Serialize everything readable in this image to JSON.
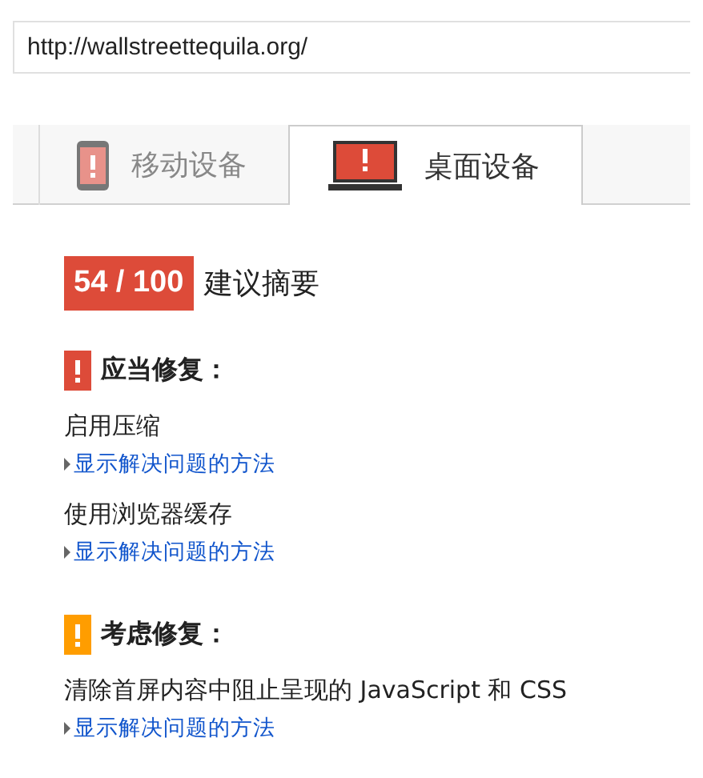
{
  "url": {
    "value": "http://wallstreettequila.org/"
  },
  "tabs": [
    {
      "label": "移动设备",
      "kind": "mobile",
      "selected": false
    },
    {
      "label": "桌面设备",
      "kind": "desktop",
      "selected": true
    }
  ],
  "score": {
    "text": "54 / 100",
    "title": "建议摘要"
  },
  "sections": [
    {
      "title": "应当修复：",
      "color": "#dd4b39",
      "items": [
        {
          "title": "启用压缩",
          "link": "显示解决问题的方法"
        },
        {
          "title": "使用浏览器缓存",
          "link": "显示解决问题的方法"
        }
      ]
    },
    {
      "title": "考虑修复：",
      "color": "#ff9d00",
      "items": [
        {
          "title": "清除首屏内容中阻止呈现的 JavaScript 和 CSS",
          "link": "显示解决问题的方法"
        }
      ]
    }
  ]
}
